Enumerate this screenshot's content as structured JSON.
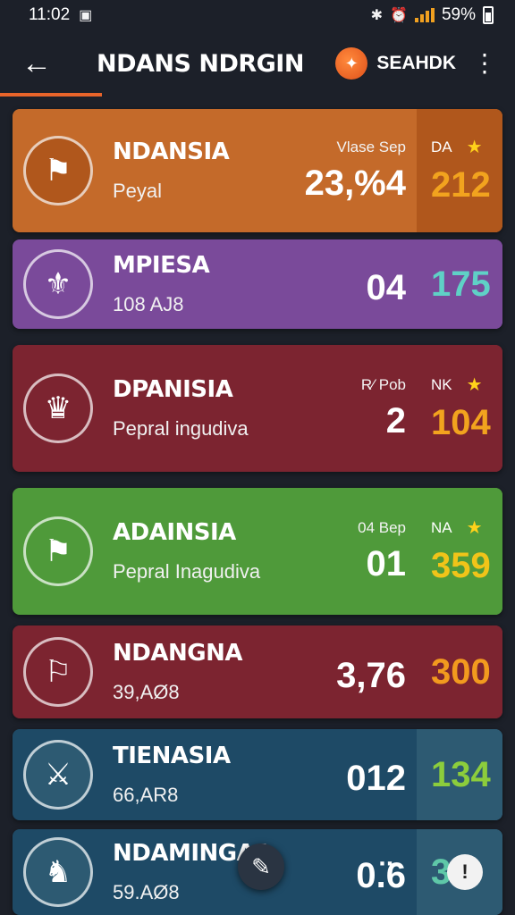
{
  "status": {
    "time": "11:02",
    "battery": "59%"
  },
  "header": {
    "back_icon": "back-arrow-icon",
    "title": "NDANS NDRGIN",
    "search_label": "SEAHDK"
  },
  "teams": [
    {
      "name": "NDANSIA",
      "subtitle": "Peyal",
      "mid_label": "Vlase Sep",
      "mid_value": "23,%4",
      "side_label": "DA",
      "score": "212",
      "starred": true,
      "bg": "#c46a2a",
      "side_bg": "#b0571c",
      "score_color": "#f2a31e"
    },
    {
      "name": "MPIESA",
      "subtitle": "108 AJ8",
      "mid_label": "",
      "mid_value": "04",
      "side_label": "",
      "score": "175",
      "starred": false,
      "bg": "#7a4a9a",
      "side_bg": "#7a4a9a",
      "score_color": "#5fd1c6"
    },
    {
      "name": "DPANISIA",
      "subtitle": "Pepral ingudiva",
      "mid_label": "R⁄ Pob",
      "mid_value": "2",
      "side_label": "NK",
      "score": "104",
      "starred": true,
      "bg": "#7c2430",
      "side_bg": "#7c2430",
      "score_color": "#f2a31e"
    },
    {
      "name": "ADAINSIA",
      "subtitle": "Pepral Inagudiva",
      "mid_label": "04 Bep",
      "mid_value": "01",
      "side_label": "NA",
      "score": "359",
      "starred": true,
      "bg": "#4f9a3a",
      "side_bg": "#4f9a3a",
      "score_color": "#f0c419"
    },
    {
      "name": "NDANGNA",
      "subtitle": "39,AØ8",
      "mid_label": "",
      "mid_value": "3,76",
      "side_label": "",
      "score": "300",
      "starred": false,
      "bg": "#7c2430",
      "side_bg": "#7c2430",
      "score_color": "#f29a1e"
    },
    {
      "name": "TIENASIA",
      "subtitle": "66,AR8",
      "mid_label": "",
      "mid_value": "012",
      "side_label": "",
      "score": "134",
      "starred": false,
      "bg": "#1e4a66",
      "side_bg": "#2d5a72",
      "score_color": "#8ccd3c"
    },
    {
      "name": "NDAMINGAA",
      "subtitle": "59.AØ8",
      "mid_label": "",
      "mid_value": "0.̈6",
      "side_label": "",
      "score": "37",
      "starred": false,
      "bg": "#1e4a66",
      "side_bg": "#2d5a72",
      "score_color": "#5fc8a8"
    }
  ],
  "colors": {
    "accent": "#e8642a",
    "star": "#ffd21a",
    "background": "#1c2029"
  }
}
